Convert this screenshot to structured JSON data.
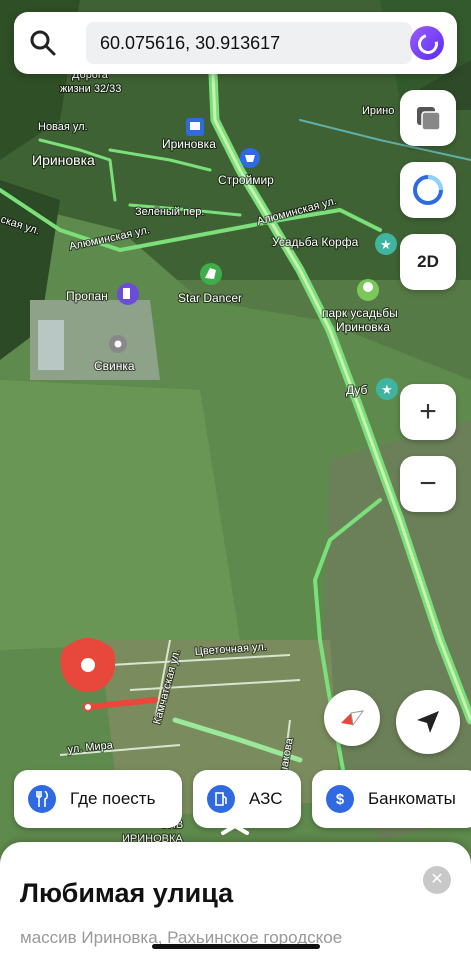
{
  "search": {
    "query": "60.075616, 30.913617"
  },
  "map_labels": {
    "doroga_1": "Дорога",
    "doroga_2": "жизни 32/33",
    "novaya": "Новая ул.",
    "irinovka_village": "Ириновка",
    "irinovka_station": "Ириновка",
    "stroymir": "Строймир",
    "zeleny": "Зелёный пер.",
    "aluminskaya_1": "Алюминская ул.",
    "aluminskaya_2": "Алюминская ул.",
    "skaya": "ская ул.",
    "usadba": "Усадьба Корфа",
    "propan": "Пропан",
    "star_dancer": "Star Dancer",
    "park_1": "парк усадьбы",
    "park_2": "Ириновка",
    "svinka": "Свинка",
    "dub": "Дуб",
    "tsvetochnaya": "Цветочная ул.",
    "kamchatskaya": "Камчатская ул.",
    "mira": "ул. Мира",
    "ushakova": "ул. Ушакова",
    "irinovka_top": "Ирино",
    "massiv_1": "СИВ",
    "massiv_2": "ИРИНОВКА"
  },
  "controls": {
    "mode_label": "2D",
    "zoom_in": "+",
    "zoom_out": "−"
  },
  "chips": [
    {
      "label": "Где поесть",
      "icon": "fork-knife-icon"
    },
    {
      "label": "АЗС",
      "icon": "gas-station-icon"
    },
    {
      "label": "Банкоматы",
      "icon": "dollar-icon",
      "glyph": "$"
    }
  ],
  "card": {
    "title": "Любимая улица",
    "subtitle": "массив Ириновка, Рахьинское городское"
  },
  "colors": {
    "road": "#7be07a",
    "pin": "#e8483b",
    "accent": "#2f6ae3"
  }
}
